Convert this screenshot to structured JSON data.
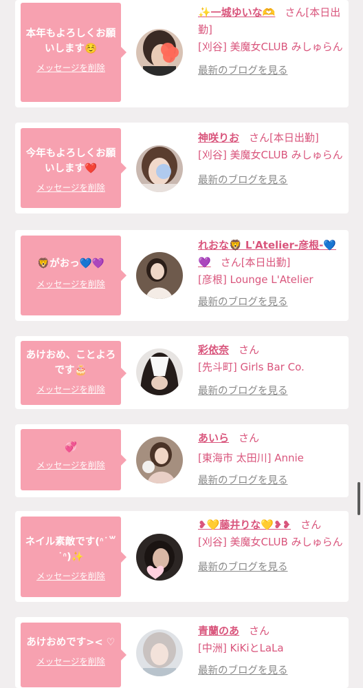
{
  "items": [
    {
      "message": "本年もよろしくお願いします☺️",
      "delete_label": "メッセージを削除",
      "name": "✨一城ゆいな🫶",
      "suffix": "さん[本日出勤]",
      "shop": "[刈谷] 美魔女CLUB みしゅらん",
      "blog_label": "最新のブログを見る",
      "avatar": "avatar-photo-woman-blurred"
    },
    {
      "message": "今年もよろしくお願いします❤️",
      "delete_label": "メッセージを削除",
      "name": "神咲りお",
      "suffix": "さん[本日出勤]",
      "shop": "[刈谷] 美魔女CLUB みしゅらん",
      "blog_label": "最新のブログを見る",
      "avatar": "avatar-photo-woman-blurred"
    },
    {
      "message": "🦁がおっ💙💜",
      "delete_label": "メッセージを削除",
      "name": "れおな🦁 L'Atelier-彦根-💙💜",
      "suffix": "さん[本日出勤]",
      "shop": "[彦根] Lounge L'Atelier",
      "blog_label": "最新のブログを見る",
      "avatar": "avatar-photo-woman"
    },
    {
      "message": "あけおめ、ことよろです🎂",
      "delete_label": "メッセージを削除",
      "name": "彩依奈",
      "suffix": "さん",
      "shop": "[先斗町] Girls Bar Co.",
      "blog_label": "最新のブログを見る",
      "avatar": "avatar-photo-woman-hidden"
    },
    {
      "message": "💞",
      "delete_label": "メッセージを削除",
      "name": "あいら",
      "suffix": "さん",
      "shop": "[東海市 太田川] Annie",
      "blog_label": "最新のブログを見る",
      "avatar": "avatar-photo-woman"
    },
    {
      "message": "ネイル素敵です(ᐢ˙꒳˙ᐢ)✨",
      "delete_label": "メッセージを削除",
      "name": "❥💛藤井りな💛❥❥",
      "suffix": "さん",
      "shop": "[刈谷] 美魔女CLUB みしゅらん",
      "blog_label": "最新のブログを見る",
      "avatar": "avatar-photo-woman-heart"
    },
    {
      "message": "あけおめです>< ♡",
      "delete_label": "メッセージを削除",
      "name": "青蘭のあ",
      "suffix": "さん",
      "shop": "[中洲] KiKiとLaLa",
      "blog_label": "最新のブログを見る",
      "avatar": "avatar-photo-woman"
    }
  ],
  "colors": {
    "accent": "#d9557c",
    "bubble": "#f7a1b0",
    "background": "#f1eeef",
    "muted": "#8a8a8a"
  }
}
